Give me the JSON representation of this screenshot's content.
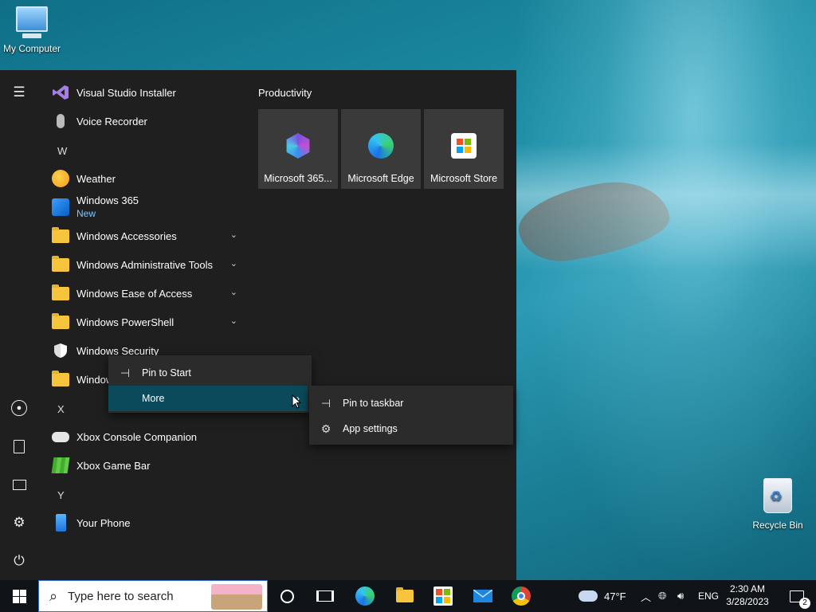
{
  "desktop": {
    "icons": [
      {
        "label": "My Computer"
      },
      {
        "label": "Recycle Bin"
      }
    ]
  },
  "start_menu": {
    "apps": [
      {
        "label": "Visual Studio Installer"
      },
      {
        "label": "Voice Recorder"
      },
      {
        "letter": "W"
      },
      {
        "label": "Weather"
      },
      {
        "label": "Windows 365",
        "sub": "New"
      },
      {
        "label": "Windows Accessories"
      },
      {
        "label": "Windows Administrative Tools"
      },
      {
        "label": "Windows Ease of Access"
      },
      {
        "label": "Windows PowerShell"
      },
      {
        "label": "Windows Security"
      },
      {
        "label": "Windows System"
      },
      {
        "letter": "X"
      },
      {
        "label": "Xbox Console Companion"
      },
      {
        "label": "Xbox Game Bar"
      },
      {
        "letter": "Y"
      },
      {
        "label": "Your Phone"
      }
    ],
    "group_title": "Productivity",
    "tiles": [
      {
        "label": "Microsoft 365...",
        "icon": "microsoft-365-icon"
      },
      {
        "label": "Microsoft Edge",
        "icon": "edge-icon"
      },
      {
        "label": "Microsoft Store",
        "icon": "store-icon"
      }
    ]
  },
  "context_menu": {
    "items": [
      {
        "label": "Pin to Start"
      },
      {
        "label": "More"
      }
    ]
  },
  "submenu": {
    "items": [
      {
        "label": "Pin to taskbar"
      },
      {
        "label": "App settings"
      }
    ]
  },
  "taskbar": {
    "search_placeholder": "Type here to search",
    "weather": "47°F",
    "language": "ENG",
    "time": "2:30 AM",
    "date": "3/28/2023",
    "notification_count": "2"
  },
  "colors": {
    "accent": "#0078d4",
    "menu_bg": "#1f1f1f",
    "hover": "#0b4a5a",
    "folder": "#f6c53d"
  }
}
